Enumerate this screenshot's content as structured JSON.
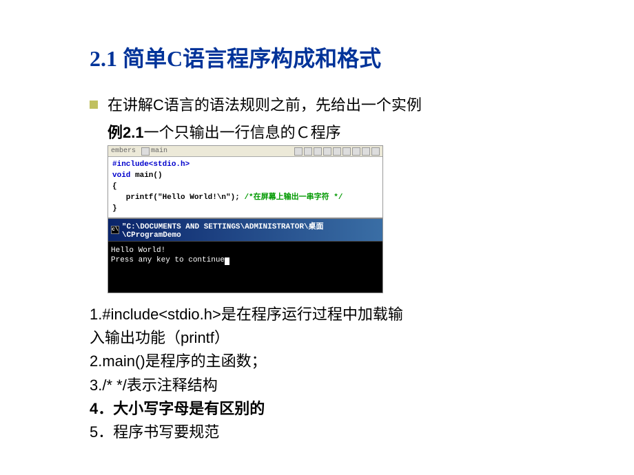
{
  "title": "2.1 简单C语言程序构成和格式",
  "intro": "在讲解C语言的语法规则之前，先给出一个实例",
  "example": {
    "label": "例2.1",
    "desc": "一个只输出一行信息的Ｃ程序"
  },
  "ide": {
    "tabs": {
      "left": "embers",
      "right": "main"
    },
    "code": {
      "line1": "#include<stdio.h>",
      "line2a": "void",
      "line2b": " main()",
      "line3": "{",
      "line4a": "   printf(\"Hello World!\\n\"); ",
      "line4b": "/*在屏幕上输出一串字符 */",
      "line5": "}"
    },
    "console": {
      "title": "\"C:\\DOCUMENTS AND SETTINGS\\ADMINISTRATOR\\桌面\\CProgramDemo",
      "out1": "Hello World!",
      "out2": "Press any key to continue"
    }
  },
  "notes": {
    "n1a": "1.#include<stdio.h>是在程序运行过程中加载输",
    "n1b": "入输出功能（printf）",
    "n2": "2.main()是程序的主函数；",
    "n3": "3./* */表示注释结构",
    "n4": "4．大小写字母是有区别的",
    "n5": "5．程序书写要规范"
  }
}
